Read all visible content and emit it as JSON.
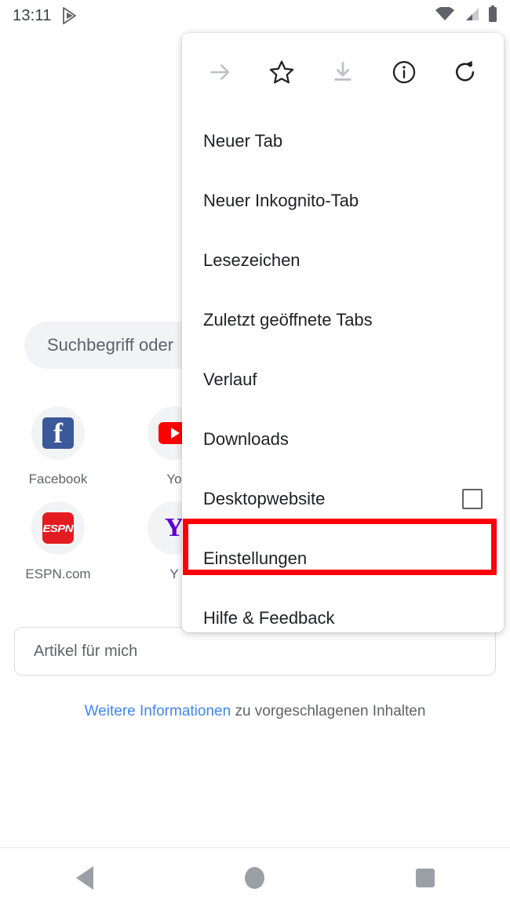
{
  "status_bar": {
    "time": "13:11",
    "play_store_icon": "play-store-icon",
    "wifi_icon": "wifi-icon",
    "signal_icon": "cellular-signal-icon",
    "battery_icon": "battery-full-icon"
  },
  "ntp": {
    "doodle_alt": "google-doodle-dotted-g",
    "search": {
      "placeholder": "Suchbegriff oder",
      "background": "#f1f3f4"
    },
    "tiles": [
      {
        "label": "Facebook",
        "icon": "facebook-icon"
      },
      {
        "label": "Yo",
        "icon": "youtube-icon"
      },
      {
        "label": "ESPN.com",
        "icon": "espn-icon"
      },
      {
        "label": "Y",
        "icon": "yahoo-icon"
      }
    ],
    "article_card": {
      "label": "Artikel für mich"
    },
    "footer": {
      "link_text": "Weitere Informationen",
      "rest_text": " zu vorgeschlagenen Inhalten",
      "link_color": "#4285f4"
    }
  },
  "menu": {
    "icons": [
      {
        "name": "forward-arrow-icon",
        "disabled": true
      },
      {
        "name": "bookmark-star-icon",
        "disabled": false
      },
      {
        "name": "download-icon",
        "disabled": true
      },
      {
        "name": "page-info-icon",
        "disabled": false
      },
      {
        "name": "reload-icon",
        "disabled": false
      }
    ],
    "items": [
      {
        "label": "Neuer Tab",
        "checkbox": false
      },
      {
        "label": "Neuer Inkognito-Tab",
        "checkbox": false
      },
      {
        "label": "Lesezeichen",
        "checkbox": false
      },
      {
        "label": "Zuletzt geöffnete Tabs",
        "checkbox": false
      },
      {
        "label": "Verlauf",
        "checkbox": false
      },
      {
        "label": "Downloads",
        "checkbox": false
      },
      {
        "label": "Desktopwebsite",
        "checkbox": true,
        "checked": false
      },
      {
        "label": "Einstellungen",
        "checkbox": false,
        "highlighted": true
      },
      {
        "label": "Hilfe & Feedback",
        "checkbox": false
      }
    ]
  },
  "annotation": {
    "highlight_color": "#fb0007",
    "highlight_target": "Einstellungen"
  },
  "navbar": {
    "back": "back-icon",
    "home": "home-icon",
    "recent": "recent-apps-icon"
  }
}
